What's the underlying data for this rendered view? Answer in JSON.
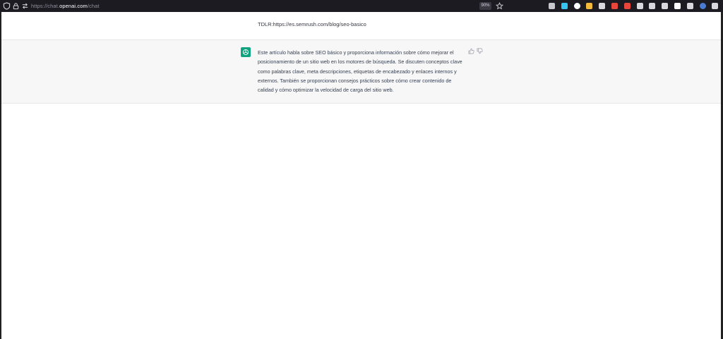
{
  "browser": {
    "url_prefix": "https://chat.",
    "url_host": "openai.com",
    "url_path": "/chat",
    "zoom": "90%",
    "extensions": [
      {
        "name": "pocket-icon",
        "color": "#c8c8cc"
      },
      {
        "name": "download-icon",
        "color": "#36c5f0"
      },
      {
        "name": "extension-badge-icon",
        "color": "#ffffff"
      },
      {
        "name": "pencil-icon",
        "color": "#f2b93b"
      },
      {
        "name": "sidebar-icon",
        "color": "#d9d9dd"
      },
      {
        "name": "red-flag-icon",
        "color": "#e8453c"
      },
      {
        "name": "record-icon",
        "color": "#e8453c"
      },
      {
        "name": "window-icon",
        "color": "#d9d9dd"
      },
      {
        "name": "image-icon",
        "color": "#d9d9dd"
      },
      {
        "name": "grid-icon",
        "color": "#d9d9dd"
      },
      {
        "name": "info-icon",
        "color": "#ffffff"
      },
      {
        "name": "list-icon",
        "color": "#d9d9dd"
      },
      {
        "name": "account-icon",
        "color": "#4a7bd4"
      },
      {
        "name": "puzzle-icon",
        "color": "#d9d9dd"
      },
      {
        "name": "menu-icon",
        "color": "#d9d9dd"
      }
    ]
  },
  "conversation": {
    "user_message": "TDLR:https://es.semrush.com/blog/seo-basico",
    "assistant_message": "Este artículo habla sobre SEO básico y proporciona información sobre cómo mejorar el posicionamiento de un sitio web en los motores de búsqueda. Se discuten conceptos clave como palabras clave, meta descripciones, etiquetas de encabezado y enlaces internos y externos. También se proporcionan consejos prácticos sobre cómo crear contenido de calidad y cómo optimizar la velocidad de carga del sitio web."
  },
  "colors": {
    "toolbar": "#1c1b22",
    "assistant_bg": "#f7f7f8",
    "avatar": "#10a37f"
  }
}
